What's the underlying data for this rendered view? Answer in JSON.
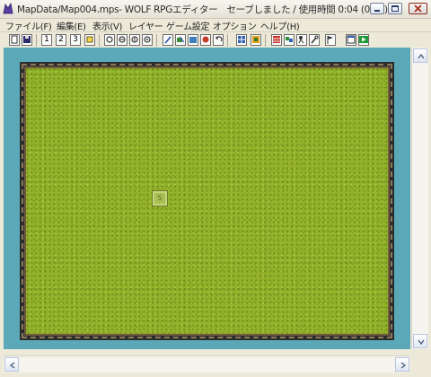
{
  "window": {
    "title": "MapData/Map004.mps- WOLF RPGエディター　セーブしました / 使用時間 0:04 (0:09)"
  },
  "menu": {
    "items": [
      "ファイル(F)",
      "編集(E)",
      "表示(V)",
      "レイヤー",
      "ゲーム設定",
      "オプション",
      "ヘルプ(H)"
    ]
  },
  "toolbar": {
    "layer_labels": [
      "1",
      "2",
      "3"
    ]
  },
  "map": {
    "start_marker_label": "S",
    "colors": {
      "background": "#5ba9b8",
      "grass": "#93b22a",
      "border": "#2c2c2c"
    }
  }
}
